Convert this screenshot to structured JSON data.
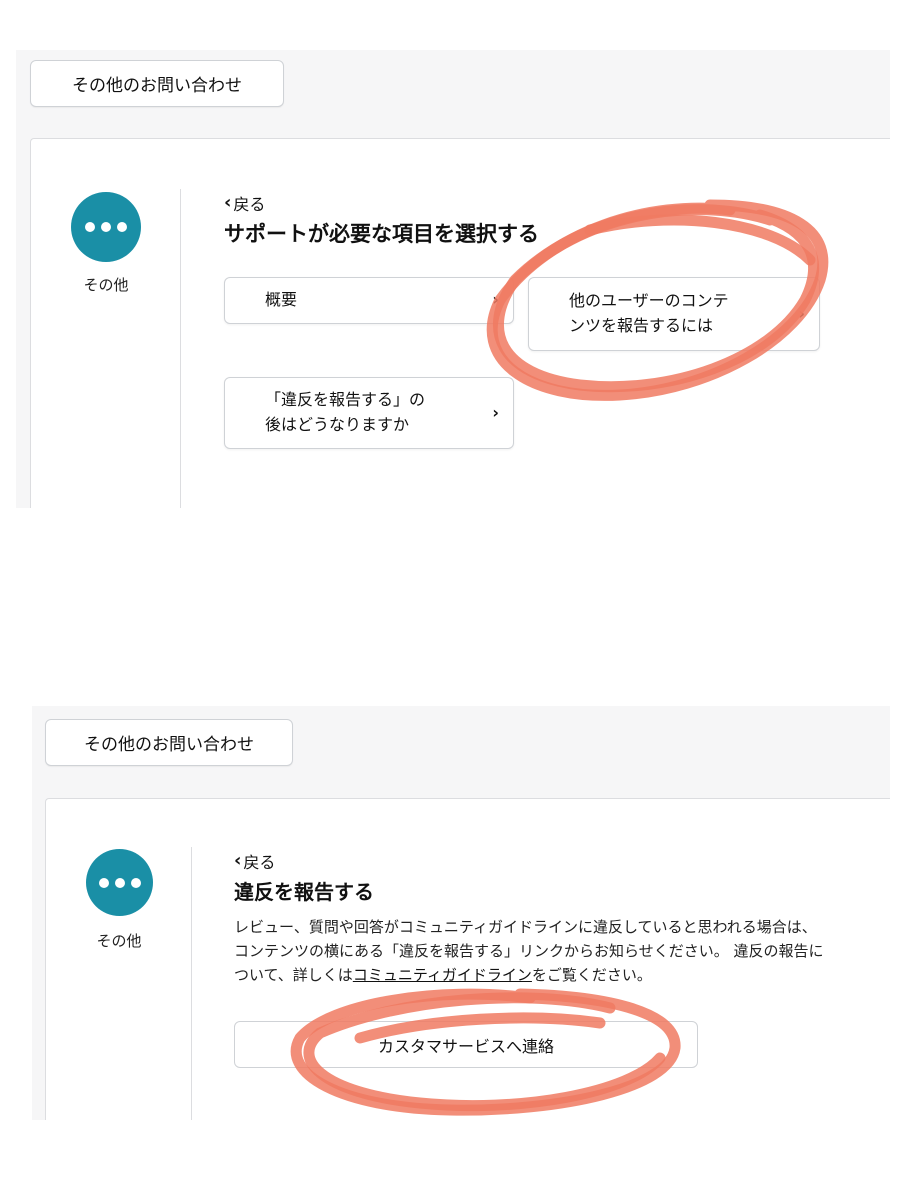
{
  "screen1": {
    "contact_button": "その他のお問い合わせ",
    "category_label": "その他",
    "back_label": "戻る",
    "title": "サポートが必要な項目を選択する",
    "topics": [
      {
        "line1": "概要",
        "line2": ""
      },
      {
        "line1": "他のユーザーのコンテ",
        "line2": "ンツを報告するには"
      },
      {
        "line1": "「違反を報告する」の",
        "line2": "後はどうなりますか"
      }
    ],
    "chevron": "›"
  },
  "screen2": {
    "contact_button": "その他のお問い合わせ",
    "category_label": "その他",
    "back_label": "戻る",
    "title": "違反を報告する",
    "description_line1": "レビュー、質問や回答がコミュニティガイドラインに違反していると思われる場合は、",
    "description_line2": "コンテンツの横にある「違反を報告する」リンクからお知らせください。 違反の報告に",
    "description_line3_pre": "ついて、詳しくは",
    "description_link": "コミュニティガイドライン",
    "description_line3_post": "をご覧ください。",
    "customer_service_button": "カスタマサービスへ連絡"
  },
  "icons": {
    "category": "more-dots-icon",
    "back": "chevron-left-icon",
    "next": "chevron-right-icon"
  },
  "colors": {
    "category_circle": "#1a8fa6",
    "annotation": "#f07a62"
  }
}
